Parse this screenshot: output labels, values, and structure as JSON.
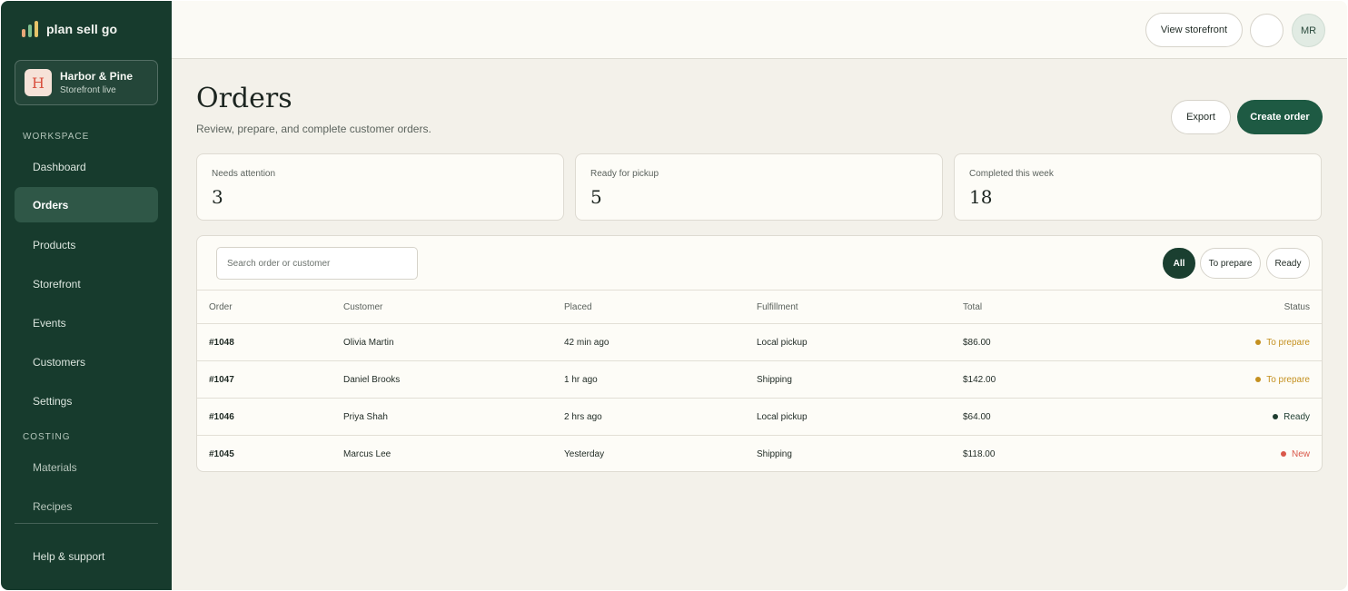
{
  "brand": {
    "name": "plan sell go",
    "bar_colors": [
      "#e8a879",
      "#7fbf8e",
      "#e7c46a"
    ]
  },
  "store": {
    "initial": "H",
    "name": "Harbor & Pine",
    "status": "Storefront live"
  },
  "sidebar": {
    "workspace_label": "WORKSPACE",
    "workspace_items": [
      {
        "label": "Dashboard"
      },
      {
        "label": "Orders",
        "active": true
      },
      {
        "label": "Products"
      },
      {
        "label": "Storefront"
      },
      {
        "label": "Events"
      },
      {
        "label": "Customers"
      },
      {
        "label": "Settings"
      }
    ],
    "costing_label": "COSTING",
    "costing_items": [
      {
        "label": "Materials"
      },
      {
        "label": "Recipes"
      }
    ],
    "help_label": "Help & support"
  },
  "topbar": {
    "view_storefront": "View storefront",
    "avatar_initials": "MR"
  },
  "page": {
    "title": "Orders",
    "subtitle": "Review, prepare, and complete customer orders.",
    "export_label": "Export",
    "create_label": "Create order"
  },
  "stats": [
    {
      "label": "Needs attention",
      "value": "3"
    },
    {
      "label": "Ready for pickup",
      "value": "5"
    },
    {
      "label": "Completed this week",
      "value": "18"
    }
  ],
  "table": {
    "search_placeholder": "Search order or customer",
    "filters": [
      "All",
      "To prepare",
      "Ready"
    ],
    "active_filter": "All",
    "columns": [
      "Order",
      "Customer",
      "Placed",
      "Fulfillment",
      "Total",
      "Status"
    ],
    "rows": [
      {
        "order": "#1048",
        "customer": "Olivia Martin",
        "placed": "42 min ago",
        "fulfillment": "Local pickup",
        "total": "$86.00",
        "status": "To prepare",
        "status_color": "#c4901f"
      },
      {
        "order": "#1047",
        "customer": "Daniel Brooks",
        "placed": "1 hr ago",
        "fulfillment": "Shipping",
        "total": "$142.00",
        "status": "To prepare",
        "status_color": "#c4901f"
      },
      {
        "order": "#1046",
        "customer": "Priya Shah",
        "placed": "2 hrs ago",
        "fulfillment": "Local pickup",
        "total": "$64.00",
        "status": "Ready",
        "status_color": "#1f3d30"
      },
      {
        "order": "#1045",
        "customer": "Marcus Lee",
        "placed": "Yesterday",
        "fulfillment": "Shipping",
        "total": "$118.00",
        "status": "New",
        "status_color": "#d9574a"
      }
    ]
  },
  "colors": {
    "sidebar_bg": "#173b2d",
    "accent": "#1e5a43",
    "page_bg": "#f3f1ea"
  }
}
